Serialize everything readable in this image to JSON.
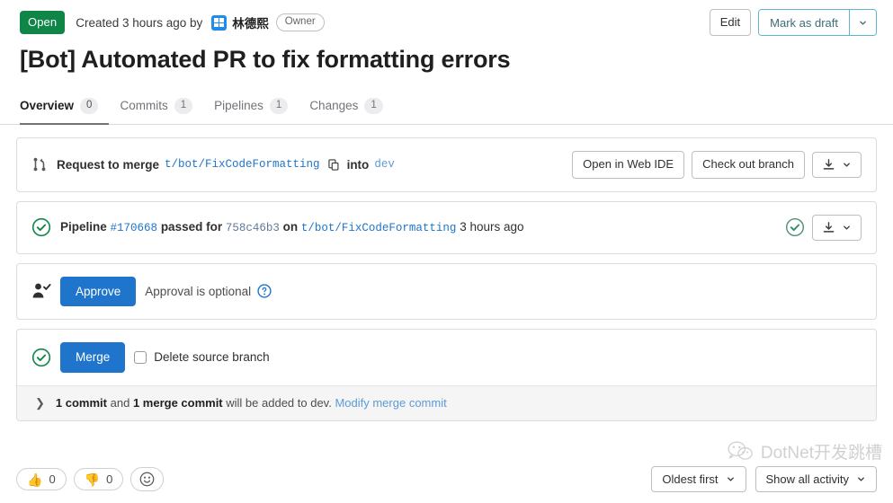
{
  "header": {
    "status": "Open",
    "created_text": "Created 3 hours ago by",
    "author": "林德熙",
    "author_role": "Owner",
    "edit_label": "Edit",
    "draft_label": "Mark as draft"
  },
  "title": "[Bot] Automated PR to fix formatting errors",
  "tabs": [
    {
      "label": "Overview",
      "count": "0",
      "active": true
    },
    {
      "label": "Commits",
      "count": "1",
      "active": false
    },
    {
      "label": "Pipelines",
      "count": "1",
      "active": false
    },
    {
      "label": "Changes",
      "count": "1",
      "active": false
    }
  ],
  "merge_request": {
    "request_label": "Request to merge",
    "source_branch": "t/bot/FixCodeFormatting",
    "into_label": "into",
    "target_branch": "dev",
    "web_ide_label": "Open in Web IDE",
    "checkout_label": "Check out branch"
  },
  "pipeline": {
    "prefix": "Pipeline",
    "id": "#170668",
    "passed_label": "passed for",
    "commit_sha": "758c46b3",
    "on_label": "on",
    "branch": "t/bot/FixCodeFormatting",
    "time": "3 hours ago"
  },
  "approval": {
    "approve_label": "Approve",
    "note": "Approval is optional"
  },
  "merge": {
    "merge_label": "Merge",
    "delete_branch_label": "Delete source branch",
    "commit_count": "1 commit",
    "and_label": "and",
    "merge_commit_count": "1 merge commit",
    "will_be_added": "will be added to dev.",
    "modify_link": "Modify merge commit"
  },
  "footer": {
    "thumbs_up_count": "0",
    "thumbs_down_count": "0",
    "sort_label": "Oldest first",
    "activity_label": "Show all activity"
  },
  "watermark": "DotNet开发跳槽",
  "colors": {
    "open_green": "#108548",
    "primary_blue": "#1f75cb",
    "success_green": "#108548",
    "link_blue": "#1f75cb"
  }
}
